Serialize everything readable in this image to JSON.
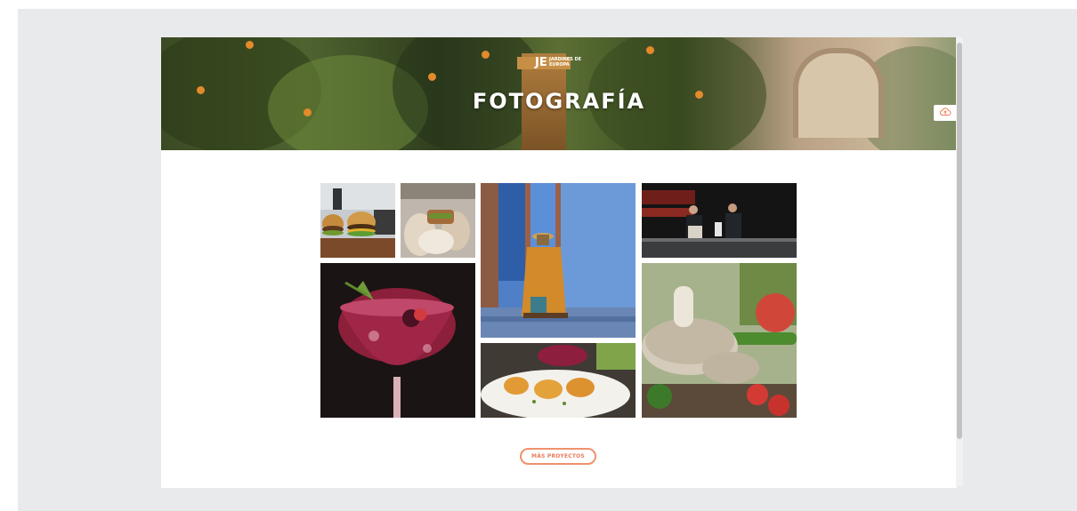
{
  "hero": {
    "logo_initials": "JE",
    "logo_text": "JARDINES DE EUROPA",
    "title": "FOTOGRAFÍA"
  },
  "icons": {
    "upload": "cloud-upload-icon"
  },
  "gallery": {
    "photos": [
      "burgers",
      "hands-with-food",
      "man-on-blue-steps",
      "stage-panel-talk",
      "red-cocktail",
      "shrimp-dish",
      "mushrooms-vegetables"
    ]
  },
  "cta": {
    "label": "MÁS PROYECTOS"
  },
  "colors": {
    "accent": "#f0926c",
    "background_frame": "#e9eaec"
  }
}
